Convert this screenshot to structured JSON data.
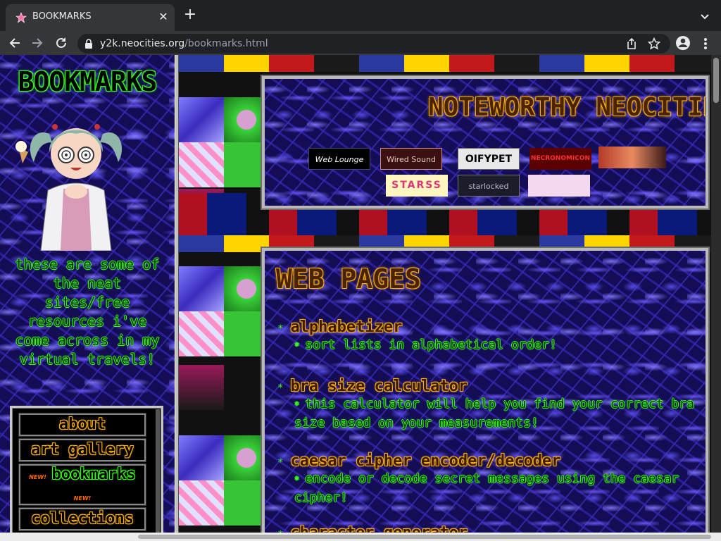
{
  "browser": {
    "tab_title": "BOOKMARKS",
    "url_host": "y2k.neocities.org",
    "url_path": "/bookmarks.html",
    "close_glyph": "✕",
    "new_tab_glyph": "+"
  },
  "sidebar": {
    "heading": "BOOKMARKS",
    "blurb": "these are some of the neat sites/free resources i've come across in my virtual travels!",
    "nav": [
      {
        "label": "about",
        "color": "orange"
      },
      {
        "label": "art gallery",
        "color": "orange"
      },
      {
        "label": "bookmarks",
        "color": "green",
        "badge": "NEW!"
      },
      {
        "label": "collections",
        "color": "orange"
      }
    ]
  },
  "noteworthy": {
    "title": "NOTEWORTHY NEOCITIES",
    "buttons": [
      {
        "label": "Web Lounge",
        "icon": "web-lounge-button"
      },
      {
        "label": "Wired Sound",
        "icon": "wired-sound-button"
      },
      {
        "label": "OIFYPET",
        "icon": "oifypet-button"
      },
      {
        "label": "NECRONOMICON",
        "icon": "necronomicon-button"
      },
      {
        "label": "",
        "icon": "anime-eyes-button"
      },
      {
        "label": "STARSS",
        "icon": "starss-button"
      },
      {
        "label": "starlocked",
        "icon": "starlocked-button"
      },
      {
        "label": "",
        "icon": "cute-face-button"
      }
    ]
  },
  "webpages": {
    "title": "WEB PAGES",
    "entries": [
      {
        "name": "alphabetizer",
        "desc": "sort lists in alphabetical order!"
      },
      {
        "name": "bra size calculator",
        "desc": "this calculator will help you find your correct bra size based on your measurements!"
      },
      {
        "name": "caesar cipher encoder/decoder",
        "desc": "encode or decode secret messages using the caesar cipher!"
      },
      {
        "name": "character generator",
        "desc": ""
      }
    ]
  },
  "colors": {
    "neon_green": "#39ff14",
    "neon_orange": "#ffb000",
    "tab_bg": "#35363a"
  }
}
